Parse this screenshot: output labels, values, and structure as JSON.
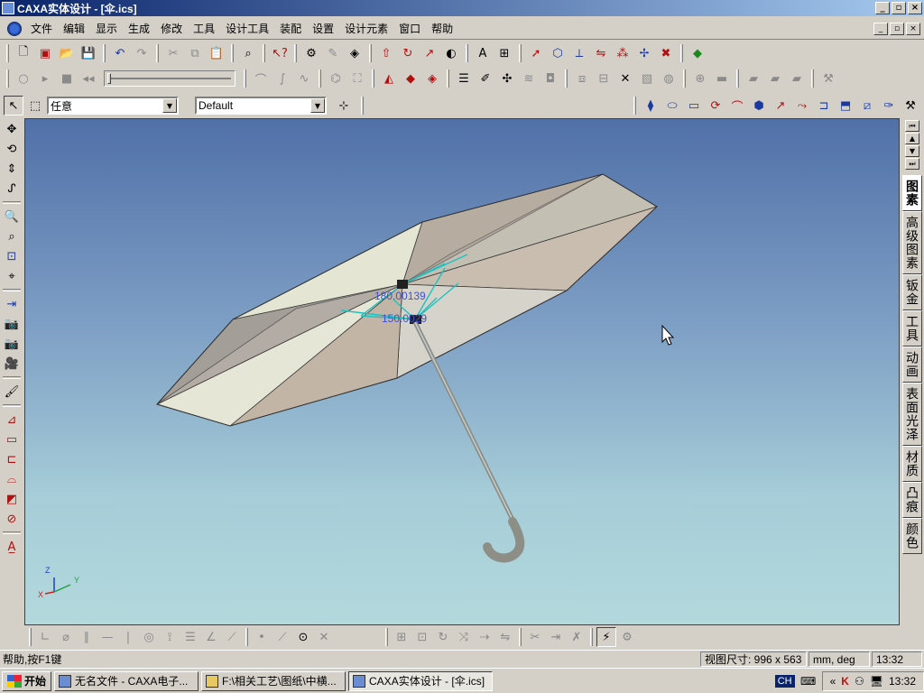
{
  "window": {
    "title": "CAXA实体设计 - [伞.ics]",
    "min_glyph": "_",
    "max_glyph": "▫",
    "close_glyph": "×"
  },
  "menu": {
    "items": [
      "文件",
      "编辑",
      "显示",
      "生成",
      "修改",
      "工具",
      "设计工具",
      "装配",
      "设置",
      "设计元素",
      "窗口",
      "帮助"
    ]
  },
  "toolbar3": {
    "filter_value": "任意",
    "render_value": "Default"
  },
  "viewport": {
    "dimension_1": "180.00139",
    "dimension_2": "150.0029",
    "axis_x": "X",
    "axis_y": "Y",
    "axis_z": "Z"
  },
  "right_tabs": [
    "图素",
    "高级图素",
    "钣金",
    "工具",
    "动画",
    "表面光泽",
    "材质",
    "凸痕",
    "颜色"
  ],
  "status": {
    "help": "帮助,按F1键",
    "view_size_label": "视图尺寸: 996 x 563",
    "units": "mm, deg",
    "time": "13:32"
  },
  "taskbar": {
    "start_label": "开始",
    "tasks": [
      {
        "label": "无名文件 - CAXA电子..."
      },
      {
        "label": "F:\\相关工艺\\图纸\\中横..."
      },
      {
        "label": "CAXA实体设计 - [伞.ics]"
      }
    ],
    "lang": "CH",
    "tray_arrows": "«",
    "clock": "13:32"
  },
  "colors": {
    "titlebar_start": "#0a246a",
    "viewport_top": "#5070a8",
    "viewport_bottom": "#b3d9dd",
    "canopy_light": "#e4e5d2",
    "canopy_dark": "#b7aca0",
    "ribs": "#20c0c0",
    "dimension_text": "#4050d0"
  }
}
